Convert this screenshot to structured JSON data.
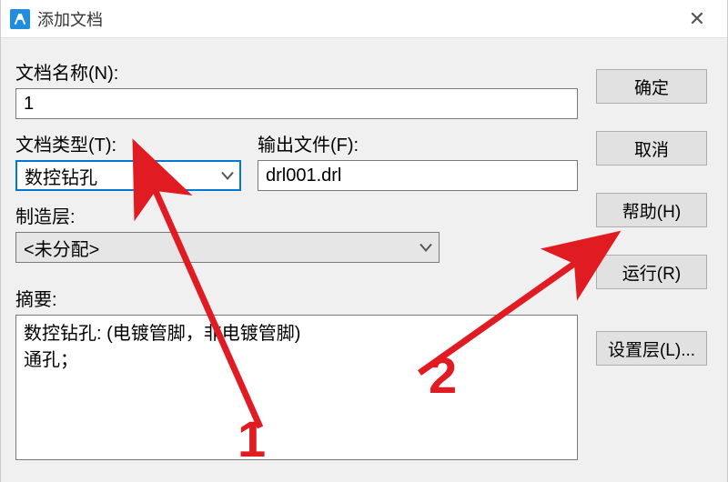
{
  "window": {
    "title": "添加文档"
  },
  "fields": {
    "doc_name": {
      "label": "文档名称(N):",
      "value": "1"
    },
    "doc_type": {
      "label": "文档类型(T):",
      "value": "数控钻孔"
    },
    "output_file": {
      "label": "输出文件(F):",
      "value": "drl001.drl"
    },
    "mfg_layer": {
      "label": "制造层:",
      "value": "<未分配>"
    },
    "summary": {
      "label": "摘要:",
      "value": "数控钻孔: (电镀管脚，非电镀管脚)\n通孔；"
    }
  },
  "buttons": {
    "ok": "确定",
    "cancel": "取消",
    "help": "帮助(H)",
    "run": "运行(R)",
    "set_layer": "设置层(L)..."
  },
  "annotations": {
    "n1": "1",
    "n2": "2"
  }
}
